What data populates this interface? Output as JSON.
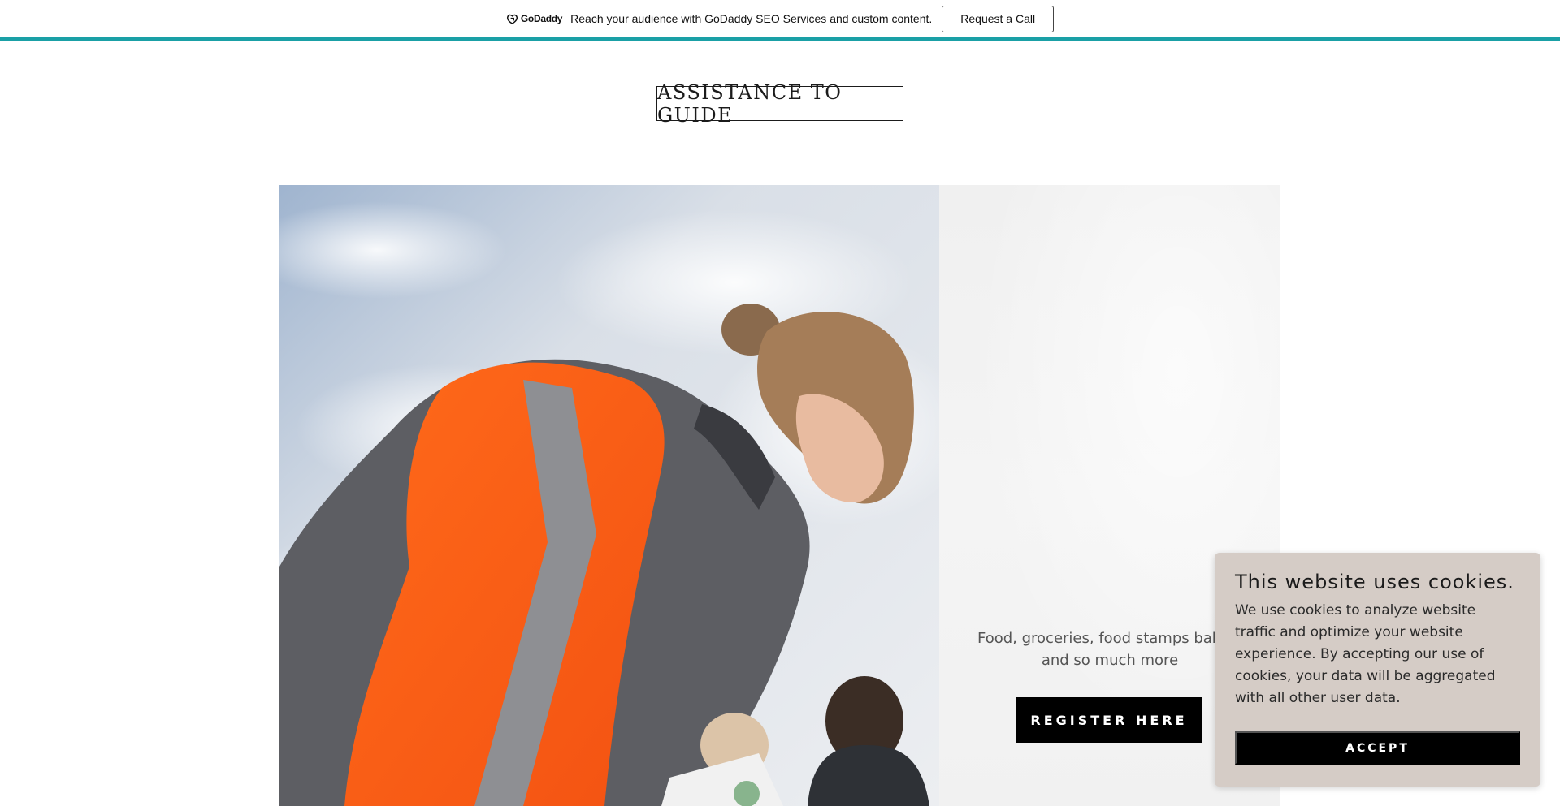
{
  "promo": {
    "brand": "GoDaddy",
    "text": "Reach your audience with GoDaddy SEO Services and custom content.",
    "cta": "Request a Call",
    "accent_color": "#1aa0a6"
  },
  "site": {
    "title": "ASSISTANCE TO GUIDE"
  },
  "hero": {
    "image": "woman-volunteer-orange-vest",
    "tagline": "Food, groceries, food stamps baby s\nand so much more",
    "cta": "REGISTER HERE"
  },
  "cookie_banner": {
    "title": "This website uses cookies.",
    "body": "We use cookies to analyze website traffic and optimize your website experience. By accepting our use of cookies, your data will be aggregated with all other user data.",
    "accept": "ACCEPT",
    "background": "#d5ccc6"
  }
}
